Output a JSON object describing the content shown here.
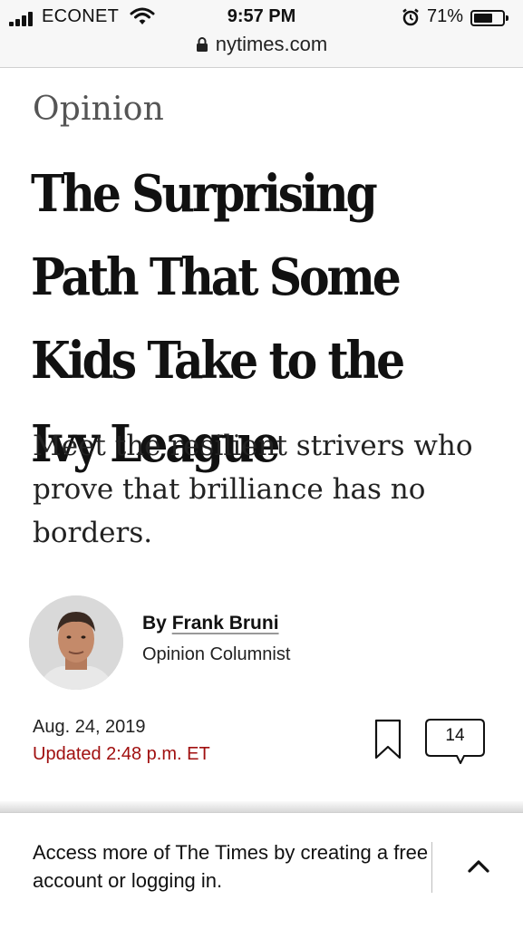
{
  "status_bar": {
    "carrier": "ECONET",
    "time": "9:57 PM",
    "battery_percent": "71%",
    "battery_level": 0.71,
    "icons": [
      "signal-icon",
      "wifi-icon",
      "alarm-icon",
      "battery-icon"
    ]
  },
  "browser": {
    "url": "nytimes.com",
    "lock_icon": "lock-icon"
  },
  "article": {
    "kicker": "Opinion",
    "headline": "The Surprising Path That Some Kids Take to the Ivy League",
    "summary": "Meet the resilient strivers who prove that brilliance has no borders.",
    "byline_prefix": "By ",
    "author": "Frank Bruni",
    "author_role": "Opinion Columnist",
    "date": "Aug. 24, 2019",
    "updated": "Updated 2:48 p.m. ET",
    "comment_count": "14"
  },
  "banner": {
    "text": "Access more of The Times by creating a free account or logging in."
  },
  "colors": {
    "updated_red": "#a00f0f",
    "kicker_gray": "#555555"
  }
}
